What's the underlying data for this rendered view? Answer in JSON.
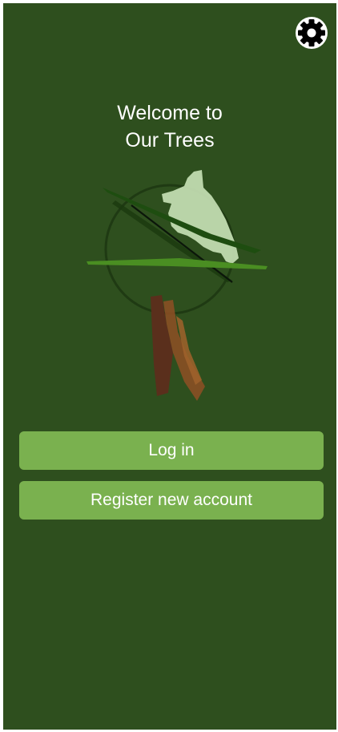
{
  "app": {
    "title_line1": "Welcome to",
    "title_line2": "Our Trees"
  },
  "header": {
    "settings_icon": "gear-icon"
  },
  "actions": {
    "login_label": "Log in",
    "register_label": "Register new account"
  },
  "colors": {
    "background": "#2e4f1e",
    "button": "#7ab14f",
    "text": "#ffffff"
  }
}
